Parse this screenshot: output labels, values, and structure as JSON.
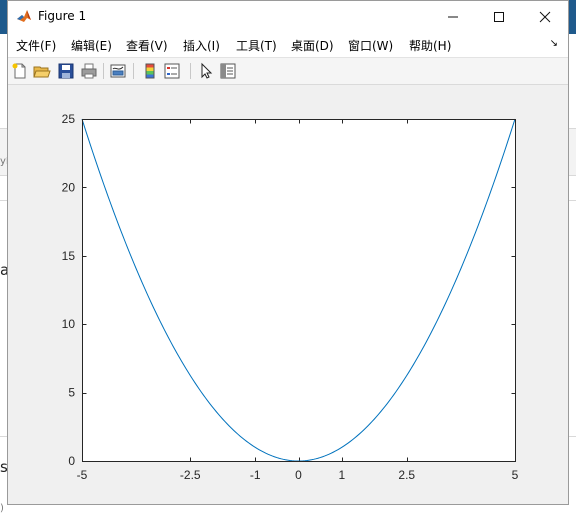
{
  "window": {
    "title": "Figure 1",
    "controls": {
      "minimize": "—",
      "maximize": "☐",
      "close": "✕"
    }
  },
  "menubar": {
    "items": [
      "文件(F)",
      "编辑(E)",
      "查看(V)",
      "插入(I)",
      "工具(T)",
      "桌面(D)",
      "窗口(W)",
      "帮助(H)"
    ],
    "overflow": "↘"
  },
  "toolbar": {
    "buttons": [
      "new-figure-icon",
      "open-file-icon",
      "save-icon",
      "print-icon",
      "link-plot-icon",
      "colorbar-icon",
      "legend-icon",
      "pointer-icon",
      "property-inspector-icon"
    ]
  },
  "background": {
    "fragments": [
      "a",
      "s",
      "yF",
      ")"
    ]
  },
  "chart_data": {
    "type": "line",
    "title": "",
    "xlabel": "",
    "ylabel": "",
    "xlim": [
      -5,
      5
    ],
    "ylim": [
      0,
      25
    ],
    "xticks": [
      -5,
      -2.5,
      -1,
      0,
      1,
      2.5,
      5
    ],
    "xtick_labels": [
      "-5",
      "-2.5",
      "-1",
      "0",
      "1",
      "2.5",
      "5"
    ],
    "yticks": [
      0,
      5,
      10,
      15,
      20,
      25
    ],
    "ytick_labels": [
      "0",
      "5",
      "10",
      "15",
      "20",
      "25"
    ],
    "grid": false,
    "series": [
      {
        "color": "#0072bd",
        "x": [
          -5,
          -4.5,
          -4,
          -3.5,
          -3,
          -2.5,
          -2,
          -1.5,
          -1,
          -0.5,
          0,
          0.5,
          1,
          1.5,
          2,
          2.5,
          3,
          3.5,
          4,
          4.5,
          5
        ],
        "y": [
          25,
          20.25,
          16,
          12.25,
          9,
          6.25,
          4,
          2.25,
          1,
          0.25,
          0,
          0.25,
          1,
          2.25,
          4,
          6.25,
          9,
          12.25,
          16,
          20.25,
          25
        ]
      }
    ]
  }
}
